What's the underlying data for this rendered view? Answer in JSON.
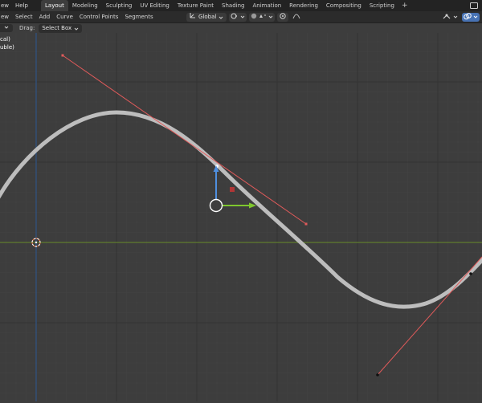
{
  "topbar": {
    "menus": [
      "ew",
      "Help"
    ],
    "workspaces": [
      {
        "label": "Layout",
        "active": true
      },
      {
        "label": "Modeling",
        "active": false
      },
      {
        "label": "Sculpting",
        "active": false
      },
      {
        "label": "UV Editing",
        "active": false
      },
      {
        "label": "Texture Paint",
        "active": false
      },
      {
        "label": "Shading",
        "active": false
      },
      {
        "label": "Animation",
        "active": false
      },
      {
        "label": "Rendering",
        "active": false
      },
      {
        "label": "Compositing",
        "active": false
      },
      {
        "label": "Scripting",
        "active": false
      }
    ],
    "add_tab": "+"
  },
  "header": {
    "menus": [
      "ew",
      "Select",
      "Add",
      "Curve",
      "Control Points",
      "Segments"
    ],
    "orientation": "Global"
  },
  "toolrow": {
    "drag_label": "Drag:",
    "drag_mode": "Select Box"
  },
  "overlay": {
    "line1": "cal)",
    "line2": "uble)"
  },
  "colors": {
    "grid_minor": "#424242",
    "grid_major": "#363636",
    "x_axis": "#6a8f2c",
    "y_axis": "#2f5a94",
    "curve": "#bdbdbd",
    "handle": "#e05a5a",
    "gizmo_y": "#4f8fdf",
    "gizmo_x": "#7fc72e",
    "selected_point": "#b03636",
    "accent": "#4772b3"
  }
}
